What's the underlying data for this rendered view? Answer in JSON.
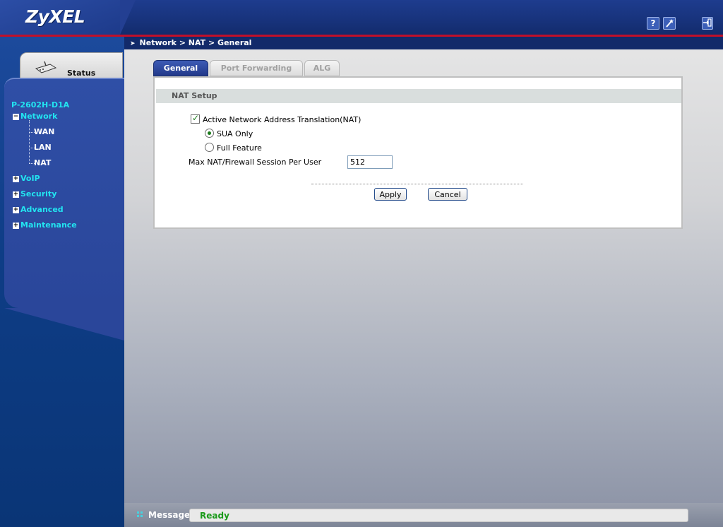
{
  "header": {
    "logo": "ZyXEL",
    "help_icon": "?",
    "wizard_icon": "wand-icon",
    "logout_icon": "logout-icon"
  },
  "sidebar": {
    "status_label": "Status",
    "device_name": "P-2602H-D1A",
    "menu": [
      {
        "label": "Network",
        "expanded": true,
        "toggle": "−"
      },
      {
        "label": "VoIP",
        "expanded": false,
        "toggle": "+"
      },
      {
        "label": "Security",
        "expanded": false,
        "toggle": "+"
      },
      {
        "label": "Advanced",
        "expanded": false,
        "toggle": "+"
      },
      {
        "label": "Maintenance",
        "expanded": false,
        "toggle": "+"
      }
    ],
    "network_sub": [
      "WAN",
      "LAN",
      "NAT"
    ]
  },
  "breadcrumb": "Network > NAT > General",
  "tabs": [
    {
      "label": "General",
      "active": true
    },
    {
      "label": "Port Forwarding",
      "active": false
    },
    {
      "label": "ALG",
      "active": false
    }
  ],
  "nat_setup": {
    "title": "NAT Setup",
    "active_nat_label": "Active Network Address Translation(NAT)",
    "active_nat_checked": true,
    "sua_only_label": "SUA Only",
    "sua_only_selected": true,
    "full_feature_label": "Full Feature",
    "full_feature_selected": false,
    "max_session_label": "Max NAT/Firewall Session Per User",
    "max_session_value": "512"
  },
  "buttons": {
    "apply": "Apply",
    "cancel": "Cancel"
  },
  "statusbar": {
    "label": "Message",
    "value": "Ready"
  },
  "colors": {
    "accent_cyan": "#22e4f0",
    "header_blue": "#17327a",
    "red_line": "#c0102a",
    "ready_green": "#1a9a1a"
  }
}
